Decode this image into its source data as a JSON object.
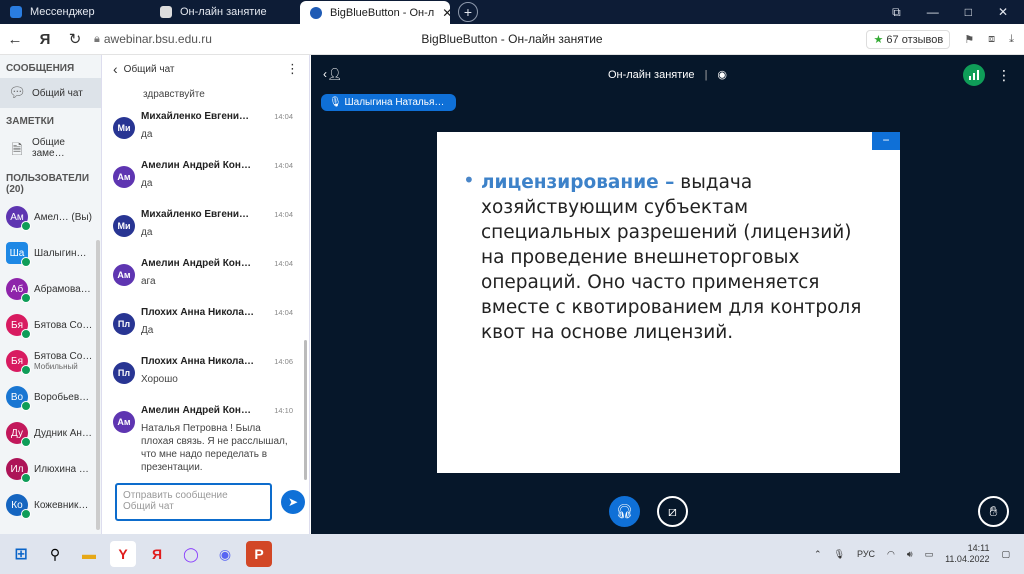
{
  "browser": {
    "tabs": [
      {
        "label": "Мессенджер",
        "active": false
      },
      {
        "label": "Он-лайн занятие",
        "active": false
      },
      {
        "label": "BigBlueButton - Он-л",
        "active": true
      }
    ],
    "new_tab": "+",
    "win_controls": [
      "⧉",
      "—",
      "□",
      "✕"
    ],
    "url": "awebinar.bsu.edu.ru",
    "page_title": "BigBlueButton - Он-лайн занятие",
    "rating": "67 отзывов"
  },
  "sidebar": {
    "messages_header": "СООБЩЕНИЯ",
    "public_chat": "Общий чат",
    "notes_header": "ЗАМЕТКИ",
    "shared_notes": "Общие заме…",
    "users_header": "ПОЛЬЗОВАТЕЛИ (20)",
    "users": [
      {
        "initials": "Ам",
        "name": "Амел… (Вы)",
        "sub": "",
        "color": "#5e35b1",
        "square": false
      },
      {
        "initials": "Ша",
        "name": "Шалыгин…",
        "sub": "",
        "color": "#1e88e5",
        "square": true
      },
      {
        "initials": "Аб",
        "name": "Абрамова…",
        "sub": "",
        "color": "#8e24aa",
        "square": false
      },
      {
        "initials": "Бя",
        "name": "Бятова Со…",
        "sub": "",
        "color": "#d81b60",
        "square": false
      },
      {
        "initials": "Бя",
        "name": "Бятова Со…",
        "sub": "Мобильный",
        "color": "#d81b60",
        "square": false
      },
      {
        "initials": "Во",
        "name": "Воробьев…",
        "sub": "",
        "color": "#1976d2",
        "square": false
      },
      {
        "initials": "Ду",
        "name": "Дудник Ан…",
        "sub": "",
        "color": "#c2185b",
        "square": false
      },
      {
        "initials": "Ил",
        "name": "Илюхина …",
        "sub": "",
        "color": "#ad1457",
        "square": false
      },
      {
        "initials": "Ко",
        "name": "Кожевник…",
        "sub": "",
        "color": "#1565c0",
        "square": false
      }
    ]
  },
  "chat": {
    "back_label": "‹",
    "title": "Общий чат",
    "first_line": "здравствуйте",
    "messages": [
      {
        "initials": "Ми",
        "name": "Михайленко Евгени…",
        "time": "14:04",
        "text": "да",
        "color": "#283593"
      },
      {
        "initials": "Ам",
        "name": "Амелин Андрей Кон…",
        "time": "14:04",
        "text": "да",
        "color": "#5e35b1"
      },
      {
        "initials": "Ми",
        "name": "Михайленко Евгени…",
        "time": "14:04",
        "text": "да",
        "color": "#283593"
      },
      {
        "initials": "Ам",
        "name": "Амелин Андрей Кон…",
        "time": "14:04",
        "text": "ага",
        "color": "#5e35b1"
      },
      {
        "initials": "Пл",
        "name": "Плохих Анна Никола…",
        "time": "14:04",
        "text": "Да",
        "color": "#283593"
      },
      {
        "initials": "Пл",
        "name": "Плохих Анна Никола…",
        "time": "14:06",
        "text": "Хорошо",
        "color": "#283593"
      },
      {
        "initials": "Ам",
        "name": "Амелин Андрей Кон…",
        "time": "14:10",
        "text": "Наталья Петровна ! Была плохая связь. Я не расслышал, что мне надо переделать в презентации.",
        "color": "#5e35b1"
      }
    ],
    "input_placeholder_1": "Отправить сообщение",
    "input_placeholder_2": "Общий чат"
  },
  "main": {
    "title": "Он-лайн занятие",
    "talker": "Шалыгина Наталья…",
    "slide_term": "лицензирование –",
    "slide_body": " выдача хозяйствующим субъектам специальных разрешений (лицензий) на проведение внешнеторговых операций. Оно часто применяется вместе с квотированием для контроля квот на основе лицензий."
  },
  "taskbar": {
    "lang": "РУС",
    "time": "14:11",
    "date": "11.04.2022"
  }
}
